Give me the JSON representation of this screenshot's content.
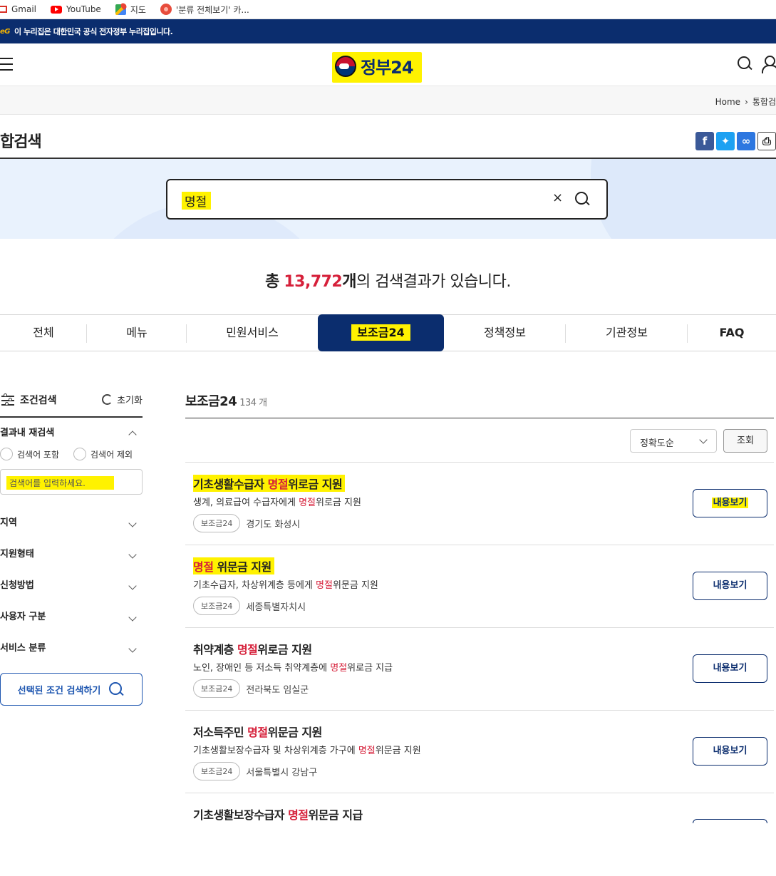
{
  "bookmarks": [
    {
      "label": "Gmail",
      "icon": "gmail-icon"
    },
    {
      "label": "YouTube",
      "icon": "youtube-icon"
    },
    {
      "label": "지도",
      "icon": "maps-icon"
    },
    {
      "label": "'분류 전체보기' 카...",
      "icon": "kakao-icon"
    }
  ],
  "gov_banner": {
    "mark": "eG",
    "text": "이 누리집은 대한민국 공식 전자정부 누리집입니다."
  },
  "header": {
    "logo_text": "정부24"
  },
  "breadcrumb": {
    "home": "Home",
    "current": "통합검"
  },
  "page_title": "합검색",
  "search": {
    "query": "명절",
    "clear": "×"
  },
  "result_count": {
    "prefix": "총",
    "number": "13,772",
    "unit": "개",
    "suffix": "의 검색결과가 있습니다."
  },
  "tabs": [
    "전체",
    "메뉴",
    "민원서비스",
    "보조금24",
    "정책정보",
    "기관정보",
    "FAQ"
  ],
  "active_tab": "보조금24",
  "sidebar": {
    "filter_label": "조건검색",
    "reset_label": "초기화",
    "refine_title": "결과내 재검색",
    "radio_include": "검색어 포함",
    "radio_exclude": "검색어 제외",
    "refine_placeholder": "검색어를 입력하세요.",
    "sections": [
      "지역",
      "지원형태",
      "신청방법",
      "사용자 구분",
      "서비스 분류"
    ],
    "apply_label": "선택된 조건 검색하기"
  },
  "main": {
    "title": "보조금24",
    "count": "134 개",
    "sort_selected": "정확도순",
    "sort_button": "조회",
    "view_label": "내용보기",
    "results": [
      {
        "title_pre": "기초생활수급자 ",
        "title_kw": "명절",
        "title_post": "위로금 지원",
        "desc_pre": "생계, 의료급여 수급자에게 ",
        "desc_kw": "명절",
        "desc_post": "위로금 지원",
        "tag": "보조금24",
        "region": "경기도 화성시"
      },
      {
        "title_pre": "",
        "title_kw": "명절",
        "title_post": " 위문금 지원",
        "desc_pre": "기초수급자, 차상위계층 등에게 ",
        "desc_kw": "명절",
        "desc_post": "위문금 지원",
        "tag": "보조금24",
        "region": "세종특별자치시"
      },
      {
        "title_pre": "취약계층 ",
        "title_kw": "명절",
        "title_post": "위로금 지원",
        "desc_pre": "노인, 장애인 등 저소득 취약계층에 ",
        "desc_kw": "명절",
        "desc_post": "위로금 지급",
        "tag": "보조금24",
        "region": "전라북도 임실군"
      },
      {
        "title_pre": "저소득주민 ",
        "title_kw": "명절",
        "title_post": "위문금 지원",
        "desc_pre": "기초생활보장수급자 및 차상위계층 가구에 ",
        "desc_kw": "명절",
        "desc_post": "위문금 지원",
        "tag": "보조금24",
        "region": "서울특별시 강남구"
      },
      {
        "title_pre": "기초생활보장수급자 ",
        "title_kw": "명절",
        "title_post": "위문금 지급"
      }
    ]
  },
  "colors": {
    "navy": "#0b2d6e",
    "keyword_red": "#d6203a",
    "highlight": "#fff200"
  }
}
